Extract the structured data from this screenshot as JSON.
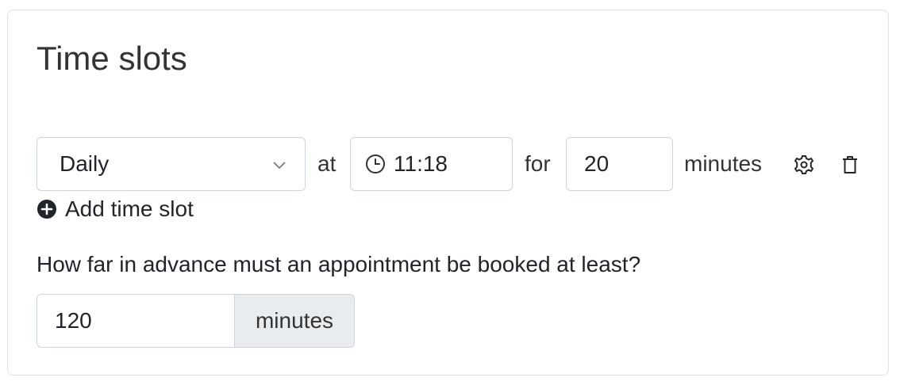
{
  "card": {
    "title": "Time slots",
    "slot": {
      "frequency": "Daily",
      "at_label": "at",
      "time": "11:18",
      "for_label": "for",
      "duration": "20",
      "unit_label": "minutes",
      "settings_icon": "gear-icon",
      "delete_icon": "trash-icon"
    },
    "add_slot_label": "Add time slot",
    "advance_question": "How far in advance must an appointment be booked at least?",
    "advance_value": "120",
    "advance_unit": "minutes"
  },
  "colors": {
    "border": "#ced4da",
    "addon_bg": "#e9ecef",
    "text": "#212529"
  }
}
